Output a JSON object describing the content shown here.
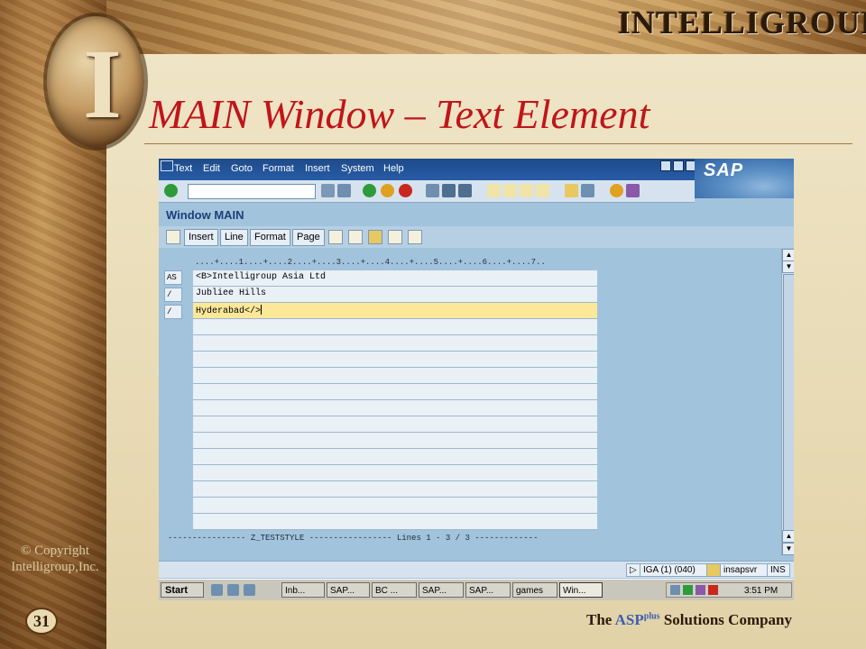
{
  "slide": {
    "brand": "INTELLIGROUP",
    "title": "MAIN Window – Text Element",
    "copyright_line1": "© Copyright",
    "copyright_line2": "Intelligroup,Inc.",
    "page_number": "31",
    "tagline_the": "The",
    "tagline_asp": "ASP",
    "tagline_plus": "plus",
    "tagline_rest": "Solutions Company"
  },
  "sap": {
    "menu": [
      "Text",
      "Edit",
      "Goto",
      "Format",
      "Insert",
      "System",
      "Help"
    ],
    "logo": "SAP",
    "screen_title": "Window MAIN",
    "app_buttons": [
      "Insert",
      "Line",
      "Format",
      "Page"
    ],
    "ruler": "....+....1....+....2....+....3....+....4....+....5....+....6....+....7..",
    "rows": [
      {
        "format": "AS",
        "text": "<B>Intelligroup Asia Ltd"
      },
      {
        "format": "/",
        "text": "Jubliee Hills"
      },
      {
        "format": "/",
        "text": "Hyderabad</>"
      }
    ],
    "status_line": "---------------- Z_TESTSTYLE ----------------- Lines 1 - 3 / 3 -------------",
    "statusbar": {
      "system": "IGA (1) (040)",
      "server": "insapsvr",
      "mode": "INS"
    },
    "taskbar": {
      "start": "Start",
      "tasks": [
        "Inb...",
        "SAP...",
        "BC ...",
        "SAP...",
        "SAP...",
        "games",
        "Win..."
      ],
      "clock": "3:51 PM"
    }
  },
  "colors": {
    "title_red": "#c0151a",
    "sap_blue": "#275ca6",
    "highlight_row": "#fde89a"
  }
}
